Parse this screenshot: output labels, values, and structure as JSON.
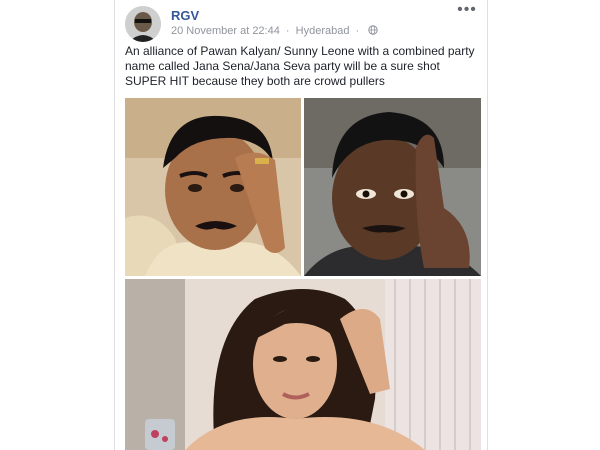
{
  "post": {
    "author": "RGV",
    "timestamp": "20 November at 22:44",
    "location": "Hyderabad",
    "text": "An alliance of Pawan Kalyan/ Sunny Leone with a combined party name called Jana Sena/Jana Seva party will be a sure shot SUPER HIT because they both are crowd pullers",
    "privacy_icon": "globe-icon",
    "options_icon": "more-options-icon",
    "options_glyph": "•••",
    "separator": "·"
  },
  "photos": [
    {
      "subject": "man with mustache, hand on forehead"
    },
    {
      "subject": "man with hand on temple"
    },
    {
      "subject": "woman with dark hair"
    }
  ],
  "colors": {
    "author_link": "#365899",
    "meta_text": "#90949c",
    "body_text": "#1d2129",
    "border": "#dddfe2"
  }
}
